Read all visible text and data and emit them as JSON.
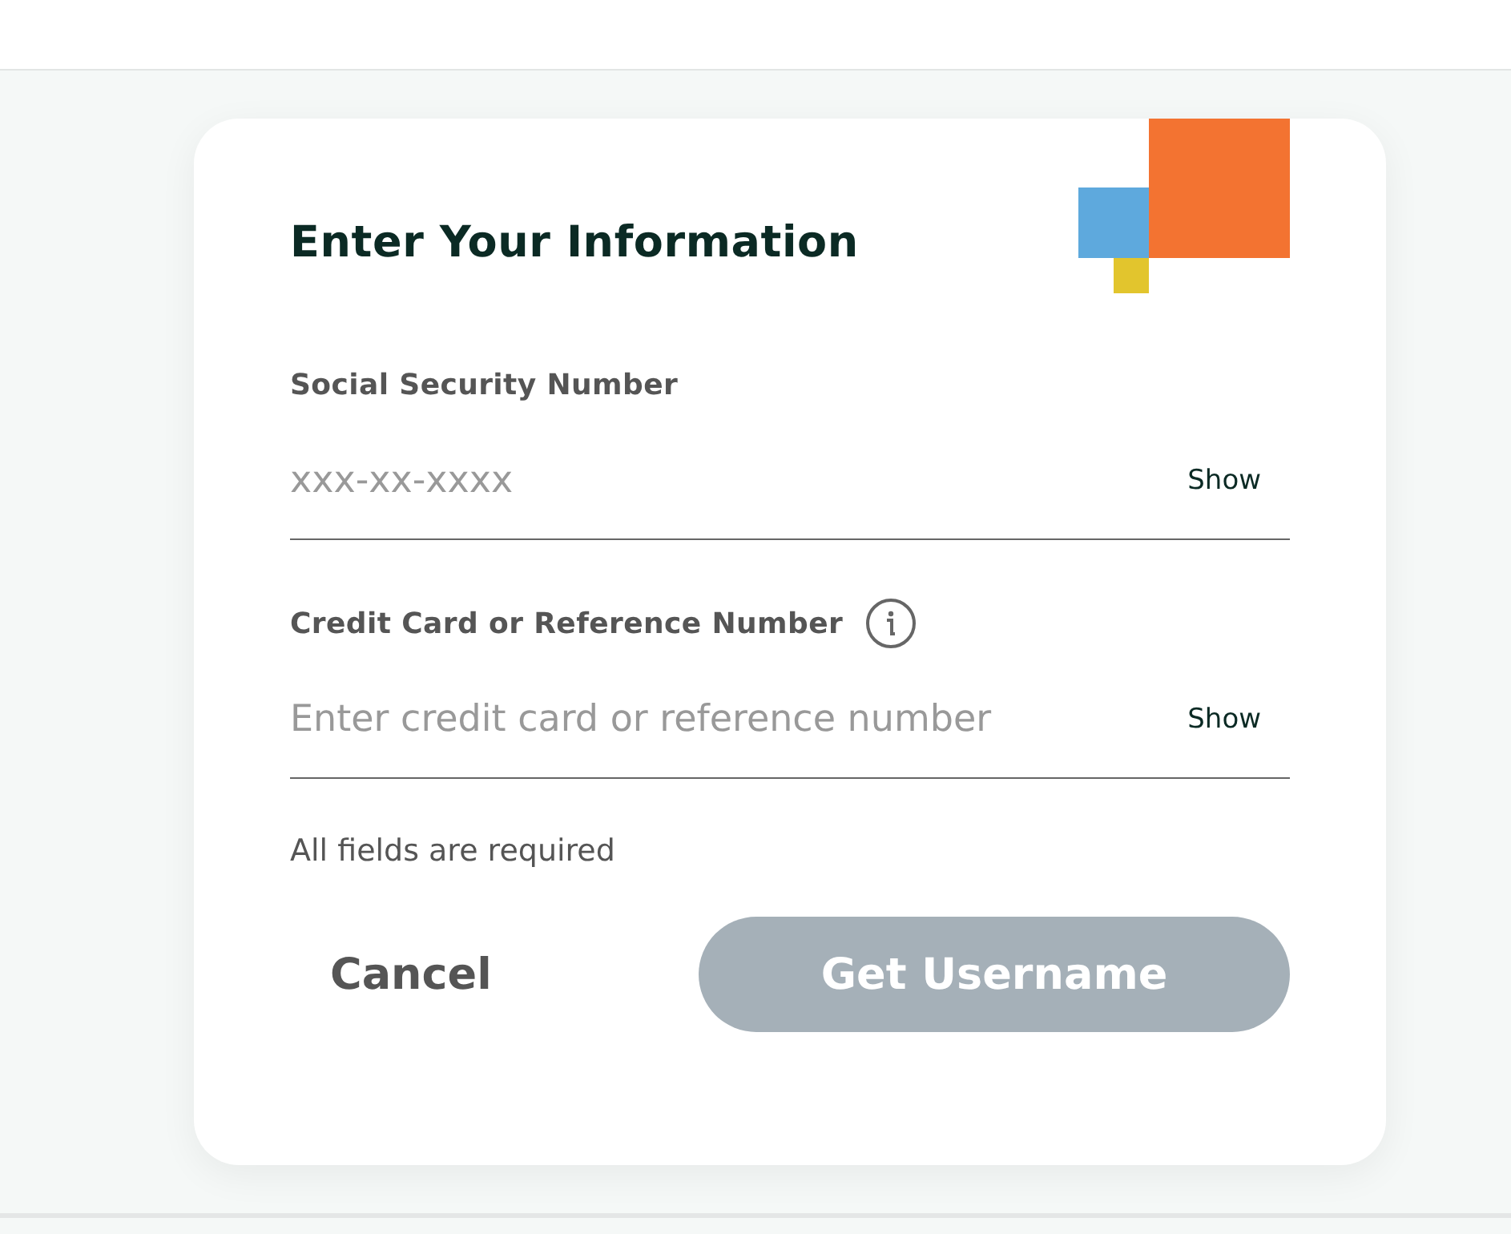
{
  "form": {
    "title": "Enter Your Information",
    "fields": [
      {
        "label": "Social Security Number",
        "placeholder": "xxx-xx-xxxx",
        "toggle": "Show",
        "info": false
      },
      {
        "label": "Credit Card or Reference Number",
        "placeholder": "Enter credit card or reference number",
        "toggle": "Show",
        "info": true
      }
    ],
    "note": "All fields are required",
    "buttons": [
      {
        "kind": "text",
        "label": "Cancel",
        "disabled": false
      },
      {
        "kind": "primary",
        "label": "Get Username",
        "disabled": true
      }
    ]
  }
}
